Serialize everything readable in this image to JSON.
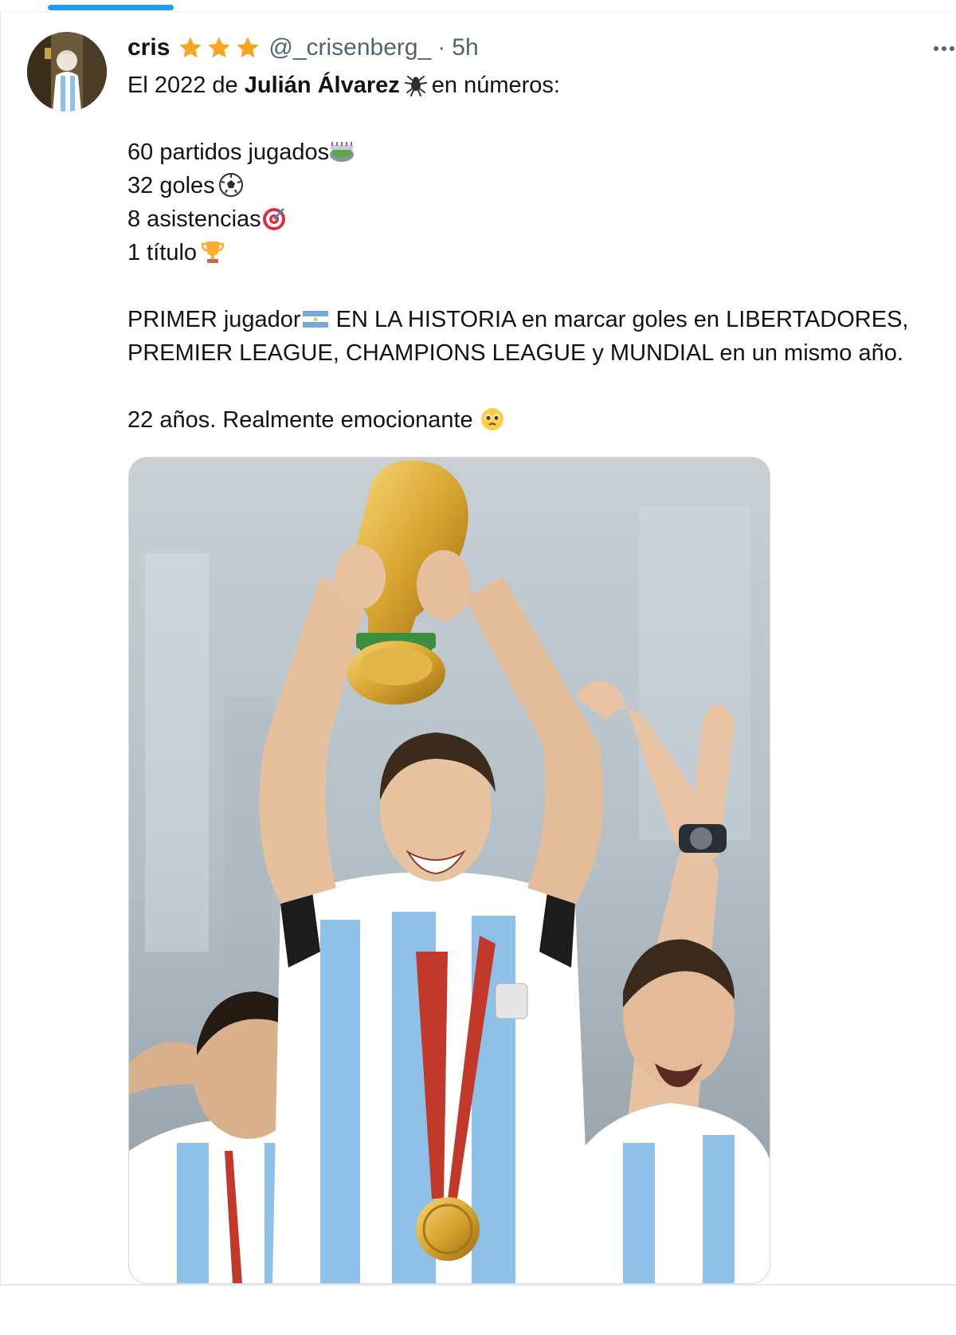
{
  "tweet": {
    "author": {
      "display_name": "cris",
      "handle": "@_crisenberg_",
      "badges": [
        "star-icon",
        "star-icon",
        "star-icon"
      ]
    },
    "separator": "·",
    "timestamp": "5h",
    "more_icon": "more-horizontal-icon",
    "text": {
      "line1_prefix": "El 2022 de ",
      "line1_bold": "Julián Álvarez",
      "line1_suffix": "en números:",
      "stat1": "60 partidos jugados",
      "stat2": "32 goles",
      "stat3": "8 asistencias",
      "stat4": "1 título",
      "para1_line1_a": "PRIMER jugador",
      "para1_line1_b": " EN LA HISTORIA en marcar goles en LIBERTADORES,",
      "para1_line2": "PREMIER LEAGUE, CHAMPIONS LEAGUE y MUNDIAL en un mismo año.",
      "closing": "22 años. Realmente emocionante"
    },
    "emojis": [
      "spider-emoji",
      "stadium-emoji",
      "soccer-ball-emoji",
      "target-emoji",
      "trophy-emoji",
      "argentina-flag-emoji",
      "teary-face-emoji"
    ]
  },
  "colors": {
    "accent": "#1d9bf0",
    "text": "#0f1419",
    "secondary": "#536471",
    "star": "#f4a623"
  }
}
